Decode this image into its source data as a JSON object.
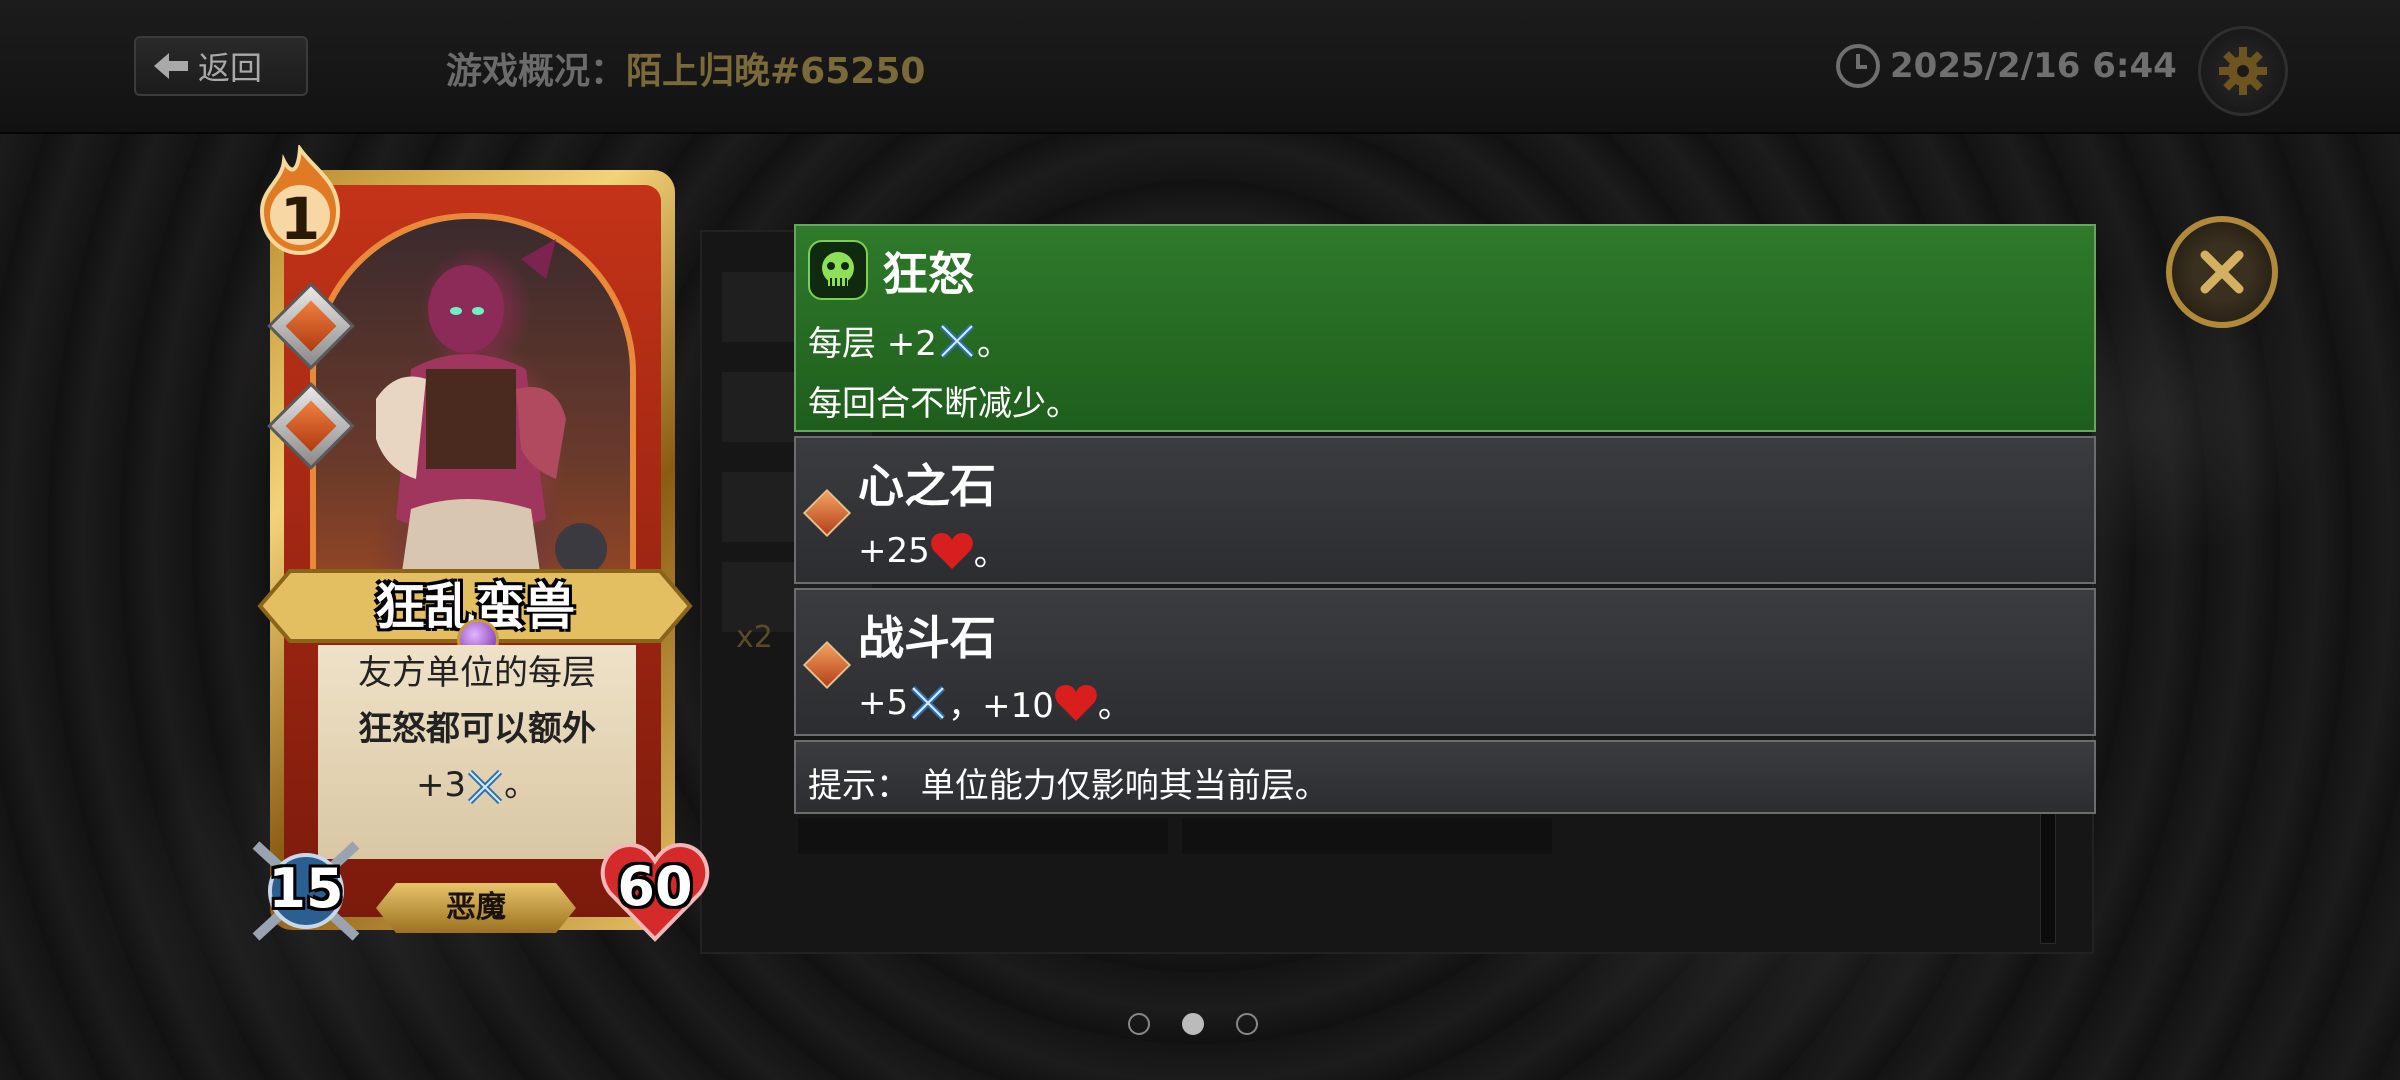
{
  "header": {
    "back_label": "返回",
    "overview_label": "游戏概况：",
    "player_name": "陌上归晚#65250",
    "datetime": "2025/2/16 6:44"
  },
  "underlay": {
    "multiplier": "x2"
  },
  "card": {
    "cost": "1",
    "name": "狂乱蛮兽",
    "description_lines": [
      "友方单位的每层",
      "狂怒都可以额外",
      "+3"
    ],
    "attack": "15",
    "health": "60",
    "type": "恶魔"
  },
  "panels": {
    "rage": {
      "title": "狂怒",
      "line1_prefix": "每层 +2",
      "line1_suffix": "。",
      "line2": "每回合不断减少。"
    },
    "heart_stone": {
      "title": "心之石",
      "text_prefix": "+25",
      "text_suffix": "。"
    },
    "battle_stone": {
      "title": "战斗石",
      "text_a": "+5",
      "text_sep": "，+10",
      "text_suffix": "。"
    },
    "hint": {
      "text": "提示：  单位能力仅影响其当前层。"
    }
  },
  "pagination": {
    "pages": 3,
    "current": 2
  },
  "colors": {
    "rage_green": "#2f7a2b",
    "accent_gold": "#b08a3a",
    "heart_red": "#d91e1e"
  }
}
